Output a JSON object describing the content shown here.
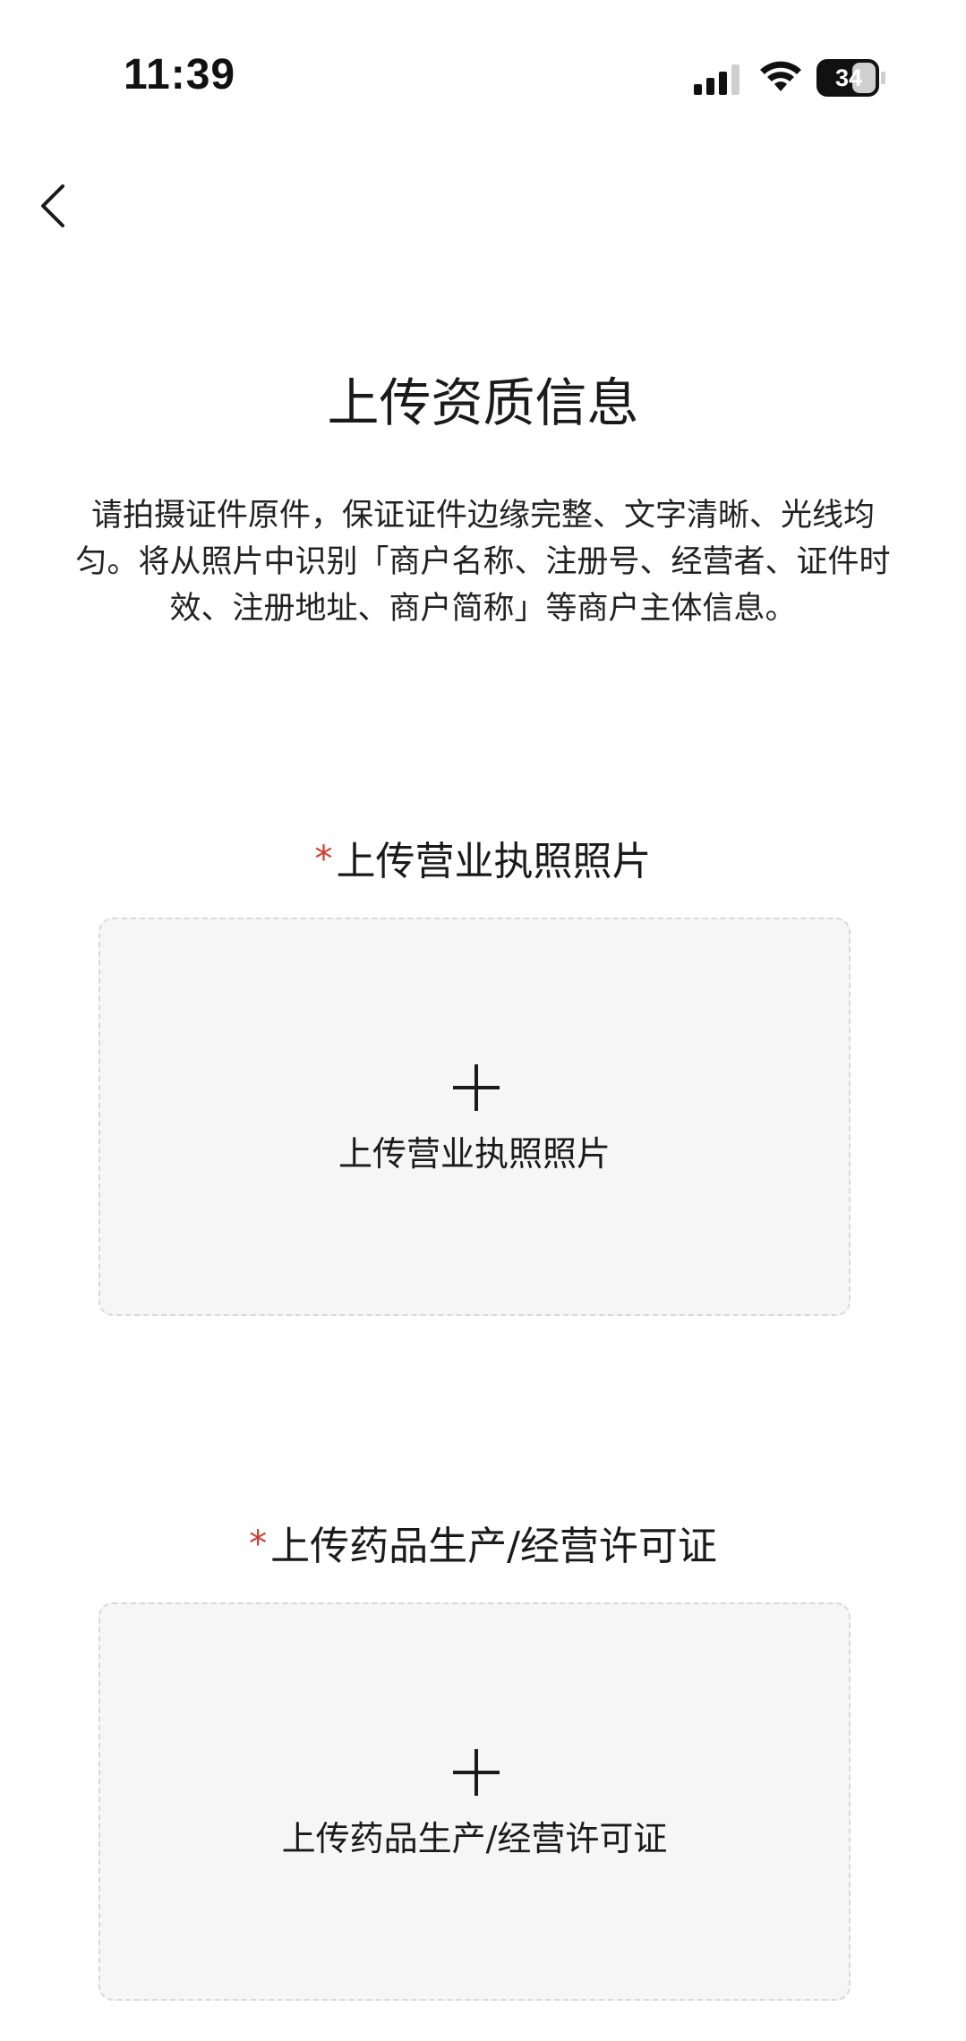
{
  "status_bar": {
    "time": "11:39",
    "battery": "34"
  },
  "header": {
    "title": "上传资质信息",
    "description": "请拍摄证件原件，保证证件边缘完整、文字清晰、光线均匀。将从照片中识别「商户名称、注册号、经营者、证件时效、注册地址、商户简称」等商户主体信息。"
  },
  "sections": [
    {
      "required_mark": "*",
      "label": "上传营业执照照片",
      "upload_text": "上传营业执照照片"
    },
    {
      "required_mark": "*",
      "label": "上传药品生产/经营许可证",
      "upload_text": "上传药品生产/经营许可证"
    }
  ],
  "colors": {
    "required": "#d33a2f",
    "upload_bg": "#f6f6f6",
    "upload_border": "#d9d9d9"
  }
}
